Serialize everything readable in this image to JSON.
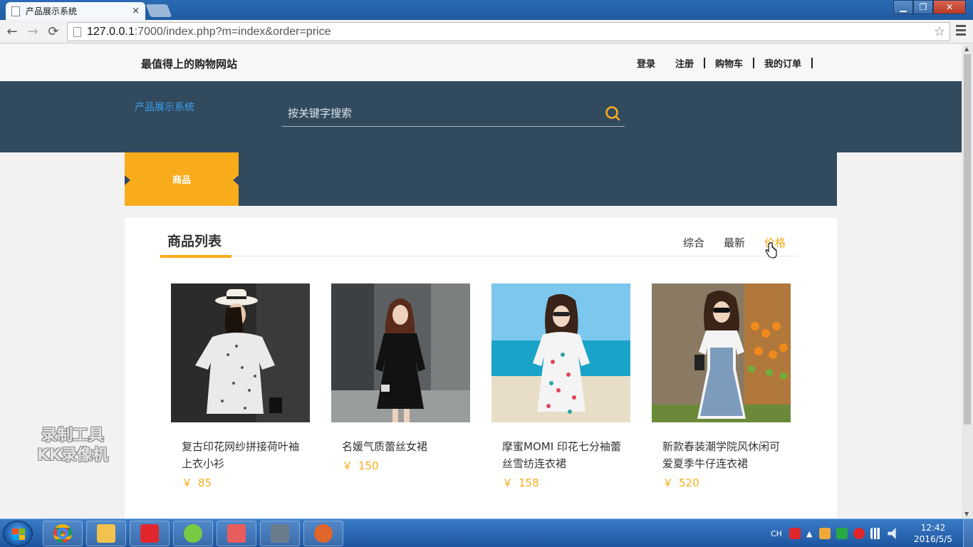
{
  "browser": {
    "tab_title": "产品展示系统",
    "tab_close": "×",
    "url_host": "127.0.0.1",
    "url_rest": ":7000/index.php?m=index&order=price",
    "back": "←",
    "forward": "→",
    "reload": "⟳",
    "star": "☆"
  },
  "window": {
    "minimize": "▁",
    "maximize": "❐",
    "close": "✕"
  },
  "site": {
    "name": "最值得上的购物网站",
    "top_links": [
      "登录",
      "注册",
      "购物车",
      "我的订单"
    ],
    "brand": "产品展示系统",
    "search_placeholder": "按关键字搜索",
    "nav_active": "商品"
  },
  "list": {
    "title": "商品列表",
    "sort": [
      "综合",
      "最新",
      "价格"
    ],
    "sort_active": 2,
    "currency": "￥"
  },
  "products": [
    {
      "name": "复古印花网纱拼接荷叶袖上衣小衫",
      "price": "85"
    },
    {
      "name": "名媛气质蕾丝女裙",
      "price": "150"
    },
    {
      "name": "摩蜜MOMI 印花七分袖蕾丝雪纺连衣裙",
      "price": "158"
    },
    {
      "name": "新款春装潮学院风休闲可爱夏季牛仔连衣裙",
      "price": "520"
    }
  ],
  "watermark": [
    "录制工具",
    "KK录像机"
  ],
  "taskbar": {
    "lang": "CH",
    "time": "12:42",
    "date": "2016/5/5"
  },
  "colors": {
    "accent": "#f9ac1b",
    "header_bg": "#324a5e",
    "brand_text": "#3aa0ef"
  }
}
